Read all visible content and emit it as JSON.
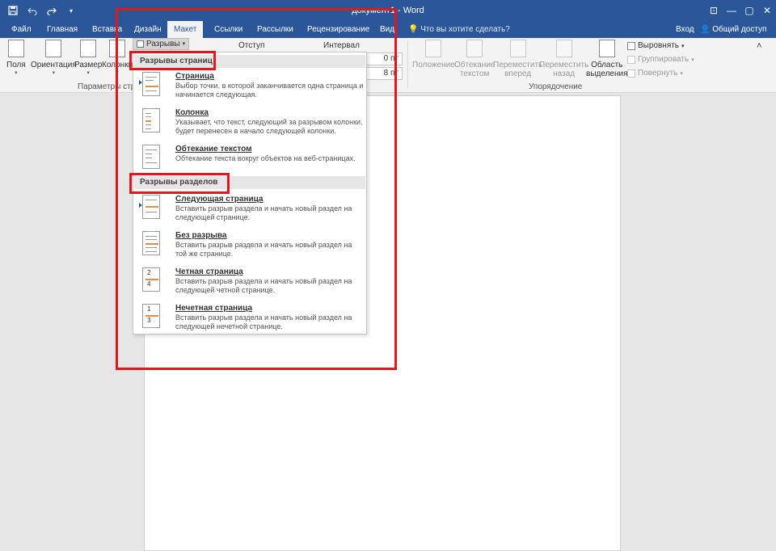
{
  "window": {
    "title": "документ1 - Word",
    "controls": [
      "?",
      "⊡",
      "—",
      "▢",
      "✕"
    ]
  },
  "quick_access": {
    "save_icon": "save-icon",
    "undo_icon": "undo-icon",
    "redo_icon": "redo-icon",
    "more_icon": "chevron-down-icon"
  },
  "tabs": [
    {
      "label": "Файл"
    },
    {
      "label": "Главная"
    },
    {
      "label": "Вставка"
    },
    {
      "label": "Дизайн"
    },
    {
      "label": "Макет",
      "active": true
    },
    {
      "label": "Ссылки"
    },
    {
      "label": "Рассылки"
    },
    {
      "label": "Рецензирование"
    },
    {
      "label": "Вид"
    }
  ],
  "tell_me": "Что вы хотите сделать?",
  "account": {
    "login": "Вход",
    "share": "Общий доступ"
  },
  "ribbon": {
    "page_setup": {
      "buttons": [
        "Поля",
        "Ориентация",
        "Размер",
        "Колонки"
      ],
      "group_label": "Параметры стра",
      "breaks_label": "Разрывы"
    },
    "paragraph": {
      "indent_label": "Отступ",
      "spacing_label": "Интервал",
      "before_value": "0 пт",
      "after_value": "8 пт"
    },
    "arrange": {
      "buttons": [
        "Положение",
        "Обтекание\nтекстом",
        "Переместить\nвперед",
        "Переместить\nназад"
      ],
      "selection_pane": "Область\nвыделения",
      "align": "Выровнять",
      "group": "Группировать",
      "rotate": "Повернуть",
      "group_label": "Упорядочение"
    }
  },
  "breaks_menu": {
    "page_breaks_header": "Разрывы страниц",
    "page_items": [
      {
        "name": "Страница",
        "desc": "Выбор точки, в которой заканчивается одна страница и начинается следующая."
      },
      {
        "name": "Колонка",
        "desc": "Указывает, что текст, следующий за разрывом колонки, будет перенесен в начало следующей колонки."
      },
      {
        "name": "Обтекание текстом",
        "desc": "Обтекание текста вокруг объектов на веб-страницах."
      }
    ],
    "section_breaks_header": "Разрывы разделов",
    "section_items": [
      {
        "name": "Следующая страница",
        "desc": "Вставить разрыв раздела и начать новый раздел на следующей странице."
      },
      {
        "name": "Без разрыва",
        "desc": "Вставить разрыв раздела и начать новый раздел на той же странице."
      },
      {
        "name": "Четная страница",
        "desc": "Вставить разрыв раздела и начать новый раздел на следующей четной странице."
      },
      {
        "name": "Нечетная страница",
        "desc": "Вставить разрыв раздела и начать новый раздел на следующей нечетной странице."
      }
    ],
    "even_numbers": [
      "2",
      "4"
    ],
    "odd_numbers": [
      "1",
      "3"
    ]
  },
  "colors": {
    "accent": "#2b579a",
    "highlight": "#e3161e",
    "break_line": "#ef8a3b"
  }
}
